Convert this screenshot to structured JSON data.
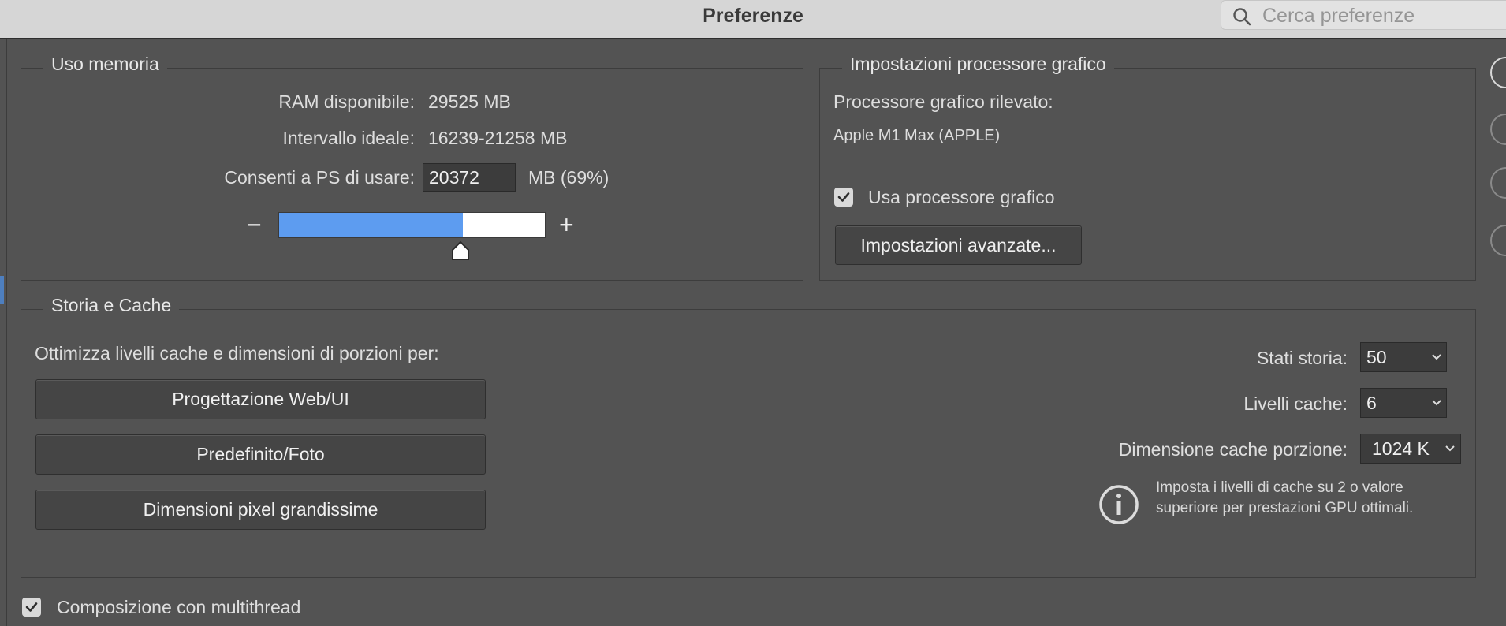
{
  "window": {
    "title": "Preferenze"
  },
  "search": {
    "placeholder": "Cerca preferenze"
  },
  "memory": {
    "legend": "Uso memoria",
    "ram_label": "RAM disponibile:",
    "ram_value": "29525 MB",
    "range_label": "Intervallo ideale:",
    "range_value": "16239-21258 MB",
    "allow_label": "Consenti a PS di usare:",
    "allow_value": "20372",
    "allow_suffix": "MB (69%)",
    "slider_percent": 69,
    "minus": "−",
    "plus": "+"
  },
  "gpu": {
    "legend": "Impostazioni processore grafico",
    "detected_label": "Processore grafico rilevato:",
    "detected_value": "Apple M1 Max (APPLE)",
    "use_label": "Usa processore grafico",
    "use_checked": true,
    "advanced_button": "Impostazioni avanzate..."
  },
  "history": {
    "legend": "Storia e Cache",
    "optimize_label": "Ottimizza livelli cache e dimensioni di porzioni per:",
    "btn_web": "Progettazione Web/UI",
    "btn_default": "Predefinito/Foto",
    "btn_huge": "Dimensioni pixel grandissime",
    "states_label": "Stati storia:",
    "states_value": "50",
    "levels_label": "Livelli cache:",
    "levels_value": "6",
    "tile_label": "Dimensione cache porzione:",
    "tile_value": "1024 K",
    "info_note": "Imposta i livelli di cache su 2 o valore superiore per prestazioni GPU ottimali."
  },
  "multithread": {
    "label": "Composizione con multithread",
    "checked": true
  },
  "colors": {
    "background": "#535353",
    "titlebar": "#d6d6d6",
    "slider_fill": "#5d9cf0",
    "checkbox": "#d9d9d9"
  }
}
